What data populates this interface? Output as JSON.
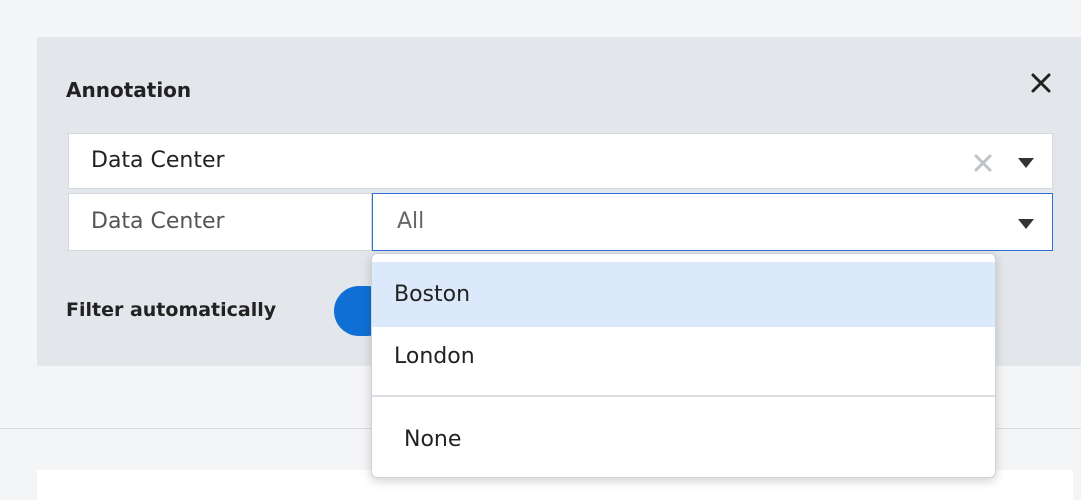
{
  "panel": {
    "title": "Annotation"
  },
  "annotation_select": {
    "value": "Data Center"
  },
  "filter": {
    "label": "Data Center",
    "value": "All"
  },
  "auto_filter": {
    "label": "Filter automatically",
    "enabled": true
  },
  "dropdown": {
    "options": [
      {
        "label": "Boston",
        "highlighted": true
      },
      {
        "label": "London",
        "highlighted": false
      }
    ],
    "none_label": "None"
  },
  "colors": {
    "accent": "#0f6fd4",
    "focus_border": "#2f6fd6",
    "highlight": "#dbe9fb",
    "panel_bg": "#e3e6ea"
  },
  "icons": {
    "close": "close-icon",
    "clear": "clear-icon",
    "caret": "caret-down-icon"
  }
}
